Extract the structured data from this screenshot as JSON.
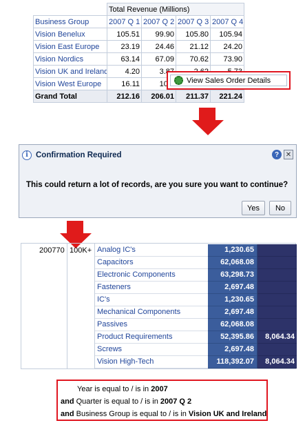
{
  "pivot": {
    "measure_header": "Total Revenue (Millions)",
    "row_header": "Business Group",
    "columns": [
      "2007 Q 1",
      "2007 Q 2",
      "2007 Q 3",
      "2007 Q 4"
    ],
    "rows": [
      {
        "label": "Vision Benelux",
        "values": [
          "105.51",
          "99.90",
          "105.80",
          "105.94"
        ]
      },
      {
        "label": "Vision East Europe",
        "values": [
          "23.19",
          "24.46",
          "21.12",
          "24.20"
        ]
      },
      {
        "label": "Vision Nordics",
        "values": [
          "63.14",
          "67.09",
          "70.62",
          "73.90"
        ]
      },
      {
        "label": "Vision UK and Ireland",
        "values": [
          "4.20",
          "3.87",
          "2.62",
          "5.73"
        ]
      },
      {
        "label": "Vision West Europe",
        "values": [
          "16.11",
          "10.7",
          "",
          ""
        ]
      }
    ],
    "total": {
      "label": "Grand Total",
      "values": [
        "212.16",
        "206.01",
        "211.37",
        "221.24"
      ]
    }
  },
  "context_menu": {
    "item_label": "View Sales Order Details",
    "icon": "gear-icon"
  },
  "dialog": {
    "title": "Confirmation Required",
    "message": "This could return a lot of records, are you sure you want to continue?",
    "yes_label": "Yes",
    "no_label": "No",
    "help_glyph": "?",
    "close_glyph": "✕",
    "info_glyph": "i"
  },
  "detail": {
    "id": "200770",
    "band": "100K+",
    "rows": [
      {
        "product": "Analog IC's",
        "value": "1,230.65",
        "value2": ""
      },
      {
        "product": "Capacitors",
        "value": "62,068.08",
        "value2": ""
      },
      {
        "product": "Electronic Components",
        "value": "63,298.73",
        "value2": ""
      },
      {
        "product": "Fasteners",
        "value": "2,697.48",
        "value2": ""
      },
      {
        "product": "IC's",
        "value": "1,230.65",
        "value2": ""
      },
      {
        "product": "Mechanical Components",
        "value": "2,697.48",
        "value2": ""
      },
      {
        "product": "Passives",
        "value": "62,068.08",
        "value2": ""
      },
      {
        "product": "Product Requirements",
        "value": "52,395.86",
        "value2": "8,064.34"
      },
      {
        "product": "Screws",
        "value": "2,697.48",
        "value2": ""
      },
      {
        "product": "Vision High-Tech",
        "value": "118,392.07",
        "value2": "8,064.34"
      }
    ]
  },
  "filter": {
    "line1_prefix": "Year is equal to / is in ",
    "line1_value": "2007",
    "line2_and": "and",
    "line2_prefix": " Quarter is equal to / is in ",
    "line2_value": "2007 Q 2",
    "line3_and": "and",
    "line3_prefix": " Business Group is equal to / is in ",
    "line3_value": "Vision UK and Ireland"
  },
  "colors": {
    "accent_red": "#e0151f",
    "link_blue": "#20459a",
    "value_cell": "#3b5d9c",
    "value_cell_dark": "#2d3369"
  }
}
